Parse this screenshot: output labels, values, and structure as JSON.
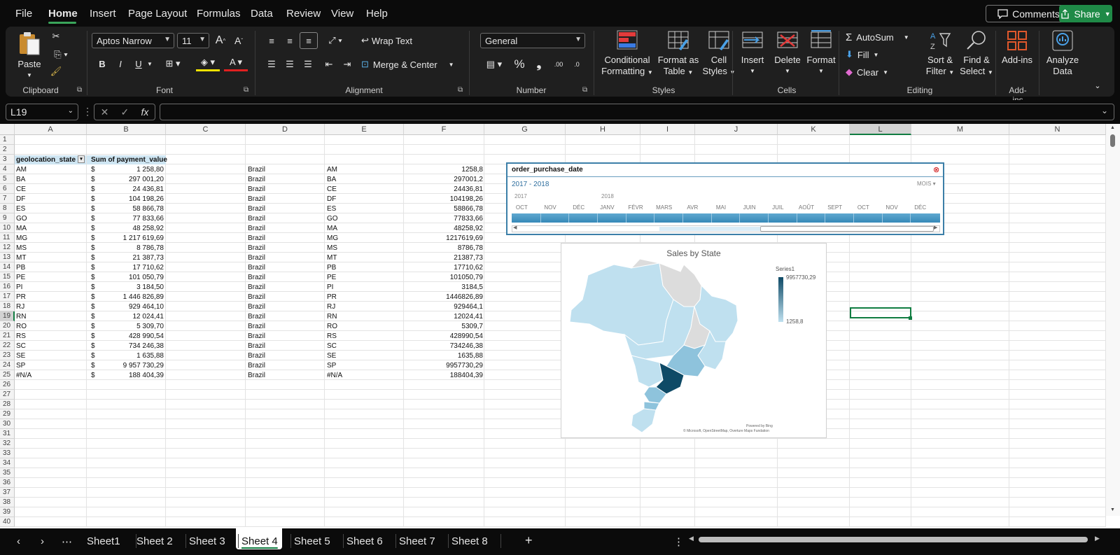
{
  "menu": {
    "items": [
      "File",
      "Home",
      "Insert",
      "Page Layout",
      "Formulas",
      "Data",
      "Review",
      "View",
      "Help"
    ],
    "active": "Home",
    "comments": "Comments",
    "share": "Share"
  },
  "ribbon": {
    "clipboard": {
      "paste": "Paste",
      "label": "Clipboard"
    },
    "font": {
      "name": "Aptos Narrow",
      "size": "11",
      "label": "Font",
      "bold": "B",
      "italic": "I",
      "underline": "U"
    },
    "alignment": {
      "wrap": "Wrap Text",
      "merge": "Merge & Center",
      "label": "Alignment"
    },
    "number": {
      "format": "General",
      "label": "Number",
      "percent": "%",
      "comma": "❟",
      "inc": ".00",
      "dec": ".0"
    },
    "styles": {
      "cond1": "Conditional",
      "cond2": "Formatting",
      "fmt1": "Format as",
      "fmt2": "Table",
      "cell1": "Cell",
      "cell2": "Styles",
      "label": "Styles"
    },
    "cells": {
      "insert": "Insert",
      "delete": "Delete",
      "format": "Format",
      "label": "Cells"
    },
    "editing": {
      "autosum": "AutoSum",
      "fill": "Fill",
      "clear": "Clear",
      "sort1": "Sort &",
      "sort2": "Filter",
      "find1": "Find &",
      "find2": "Select",
      "label": "Editing"
    },
    "addins": {
      "btn": "Add-ins",
      "label": "Add-ins"
    },
    "analyze": {
      "l1": "Analyze",
      "l2": "Data"
    }
  },
  "formula": {
    "namebox": "L19",
    "fx": "fx",
    "value": ""
  },
  "columns": [
    "A",
    "B",
    "C",
    "D",
    "E",
    "F",
    "G",
    "H",
    "I",
    "J",
    "K",
    "L",
    "M",
    "N"
  ],
  "selected_col": "L",
  "selected_cell": "L19",
  "pivot": {
    "header_state": "geolocation_state",
    "header_sum": "Sum of payment_value",
    "currency": "$",
    "rows": [
      {
        "state": "AM",
        "value": "1 258,80"
      },
      {
        "state": "BA",
        "value": "297 001,20"
      },
      {
        "state": "CE",
        "value": "24 436,81"
      },
      {
        "state": "DF",
        "value": "104 198,26"
      },
      {
        "state": "ES",
        "value": "58 866,78"
      },
      {
        "state": "GO",
        "value": "77 833,66"
      },
      {
        "state": "MA",
        "value": "48 258,92"
      },
      {
        "state": "MG",
        "value": "1 217 619,69"
      },
      {
        "state": "MS",
        "value": "8 786,78"
      },
      {
        "state": "MT",
        "value": "21 387,73"
      },
      {
        "state": "PB",
        "value": "17 710,62"
      },
      {
        "state": "PE",
        "value": "101 050,79"
      },
      {
        "state": "PI",
        "value": "3 184,50"
      },
      {
        "state": "PR",
        "value": "1 446 826,89"
      },
      {
        "state": "RJ",
        "value": "929 464,10"
      },
      {
        "state": "RN",
        "value": "12 024,41"
      },
      {
        "state": "RO",
        "value": "5 309,70"
      },
      {
        "state": "RS",
        "value": "428 990,54"
      },
      {
        "state": "SC",
        "value": "734 246,38"
      },
      {
        "state": "SE",
        "value": "1 635,88"
      },
      {
        "state": "SP",
        "value": "9 957 730,29"
      },
      {
        "state": "#N/A",
        "value": "188 404,39"
      }
    ]
  },
  "table2": {
    "country": "Brazil",
    "rows": [
      {
        "state": "AM",
        "value": "1258,8"
      },
      {
        "state": "BA",
        "value": "297001,2"
      },
      {
        "state": "CE",
        "value": "24436,81"
      },
      {
        "state": "DF",
        "value": "104198,26"
      },
      {
        "state": "ES",
        "value": "58866,78"
      },
      {
        "state": "GO",
        "value": "77833,66"
      },
      {
        "state": "MA",
        "value": "48258,92"
      },
      {
        "state": "MG",
        "value": "1217619,69"
      },
      {
        "state": "MS",
        "value": "8786,78"
      },
      {
        "state": "MT",
        "value": "21387,73"
      },
      {
        "state": "PB",
        "value": "17710,62"
      },
      {
        "state": "PE",
        "value": "101050,79"
      },
      {
        "state": "PI",
        "value": "3184,5"
      },
      {
        "state": "PR",
        "value": "1446826,89"
      },
      {
        "state": "RJ",
        "value": "929464,1"
      },
      {
        "state": "RN",
        "value": "12024,41"
      },
      {
        "state": "RO",
        "value": "5309,7"
      },
      {
        "state": "RS",
        "value": "428990,54"
      },
      {
        "state": "SC",
        "value": "734246,38"
      },
      {
        "state": "SE",
        "value": "1635,88"
      },
      {
        "state": "SP",
        "value": "9957730,29"
      },
      {
        "state": "#N/A",
        "value": "188404,39"
      }
    ]
  },
  "slicer": {
    "title": "order_purchase_date",
    "range": "2017 - 2018",
    "unit": "MOIS",
    "year1": "2017",
    "year2": "2018",
    "months": [
      "OCT",
      "NOV",
      "DÉC",
      "JANV",
      "FÉVR",
      "MARS",
      "AVR",
      "MAI",
      "JUIN",
      "JUIL",
      "AOÛT",
      "SEPT",
      "OCT",
      "NOV",
      "DÉC"
    ]
  },
  "map": {
    "title": "Sales by State",
    "legend_title": "Series1",
    "legend_max": "9957730,29",
    "legend_min": "1258,8",
    "credit1": "Powered by Bing",
    "credit2": "© Microsoft, OpenStreetMap, Overture Maps Fundation",
    "colors": {
      "dark": "#0e4a66",
      "mid": "#8ec3dc",
      "light": "#bfe0ef",
      "none": "#dcdcdc"
    }
  },
  "tabs": [
    "Sheet1",
    "Sheet 2",
    "Sheet 3",
    "Sheet 4",
    "Sheet 5",
    "Sheet 6",
    "Sheet 7",
    "Sheet 8"
  ],
  "active_tab": "Sheet 4",
  "row_numbers": [
    "1",
    "2",
    "3",
    "4",
    "5",
    "6",
    "7",
    "8",
    "9",
    "10",
    "11",
    "12",
    "13",
    "14",
    "15",
    "16",
    "17",
    "18",
    "19",
    "20",
    "21",
    "22",
    "23",
    "24",
    "25",
    "26",
    "27",
    "28",
    "29",
    "30",
    "31",
    "32",
    "33",
    "34",
    "35",
    "36",
    "37",
    "38",
    "39",
    "40"
  ]
}
